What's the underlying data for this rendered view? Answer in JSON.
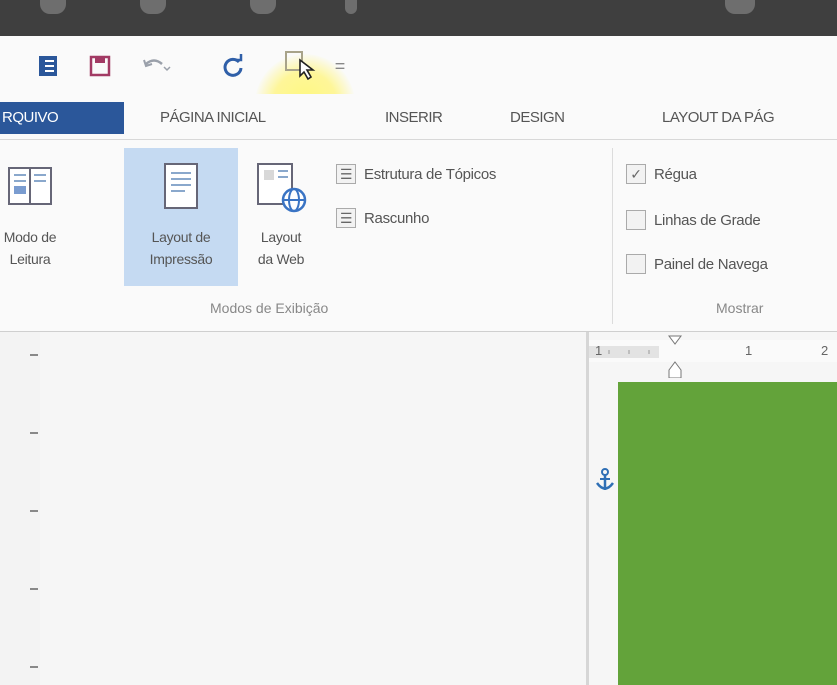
{
  "quick_access": {
    "icons": [
      "word-icon",
      "save-icon",
      "undo-icon",
      "redo-icon",
      "touch-mode-icon",
      "customize-icon"
    ],
    "customize_glyph": "="
  },
  "tabs": [
    {
      "label": "RQUIVO"
    },
    {
      "label": "PÁGINA INICIAL"
    },
    {
      "label": "INSERIR"
    },
    {
      "label": "DESIGN"
    },
    {
      "label": "LAYOUT DA PÁG"
    }
  ],
  "ribbon": {
    "exibicao_group": {
      "buttons": [
        {
          "label": "Modo de\nLeitura",
          "icon": "read-mode-icon"
        },
        {
          "label": "Layout de\nImpressão",
          "icon": "print-layout-icon"
        },
        {
          "label": "Layout\nda Web",
          "icon": "web-layout-icon"
        }
      ],
      "checkboxes": [
        {
          "label": "Estrutura de Tópicos"
        },
        {
          "label": "Rascunho"
        }
      ],
      "group_label": "Modos de Exibição"
    },
    "mostrar_group": {
      "checkboxes": [
        {
          "label": "Régua",
          "checked": true
        },
        {
          "label": "Linhas de Grade",
          "checked": false
        },
        {
          "label": "Painel de Navega",
          "checked": false
        }
      ],
      "group_label": "Mostrar"
    }
  },
  "ruler": {
    "labels": [
      "1",
      "1",
      "2"
    ]
  },
  "colors": {
    "file_tab": "#2b579a",
    "active_view_button": "#c5daf2",
    "shape_fill": "#63a33a",
    "cursor_highlight": "#fff57a",
    "anchor": "#2f6fb5"
  }
}
